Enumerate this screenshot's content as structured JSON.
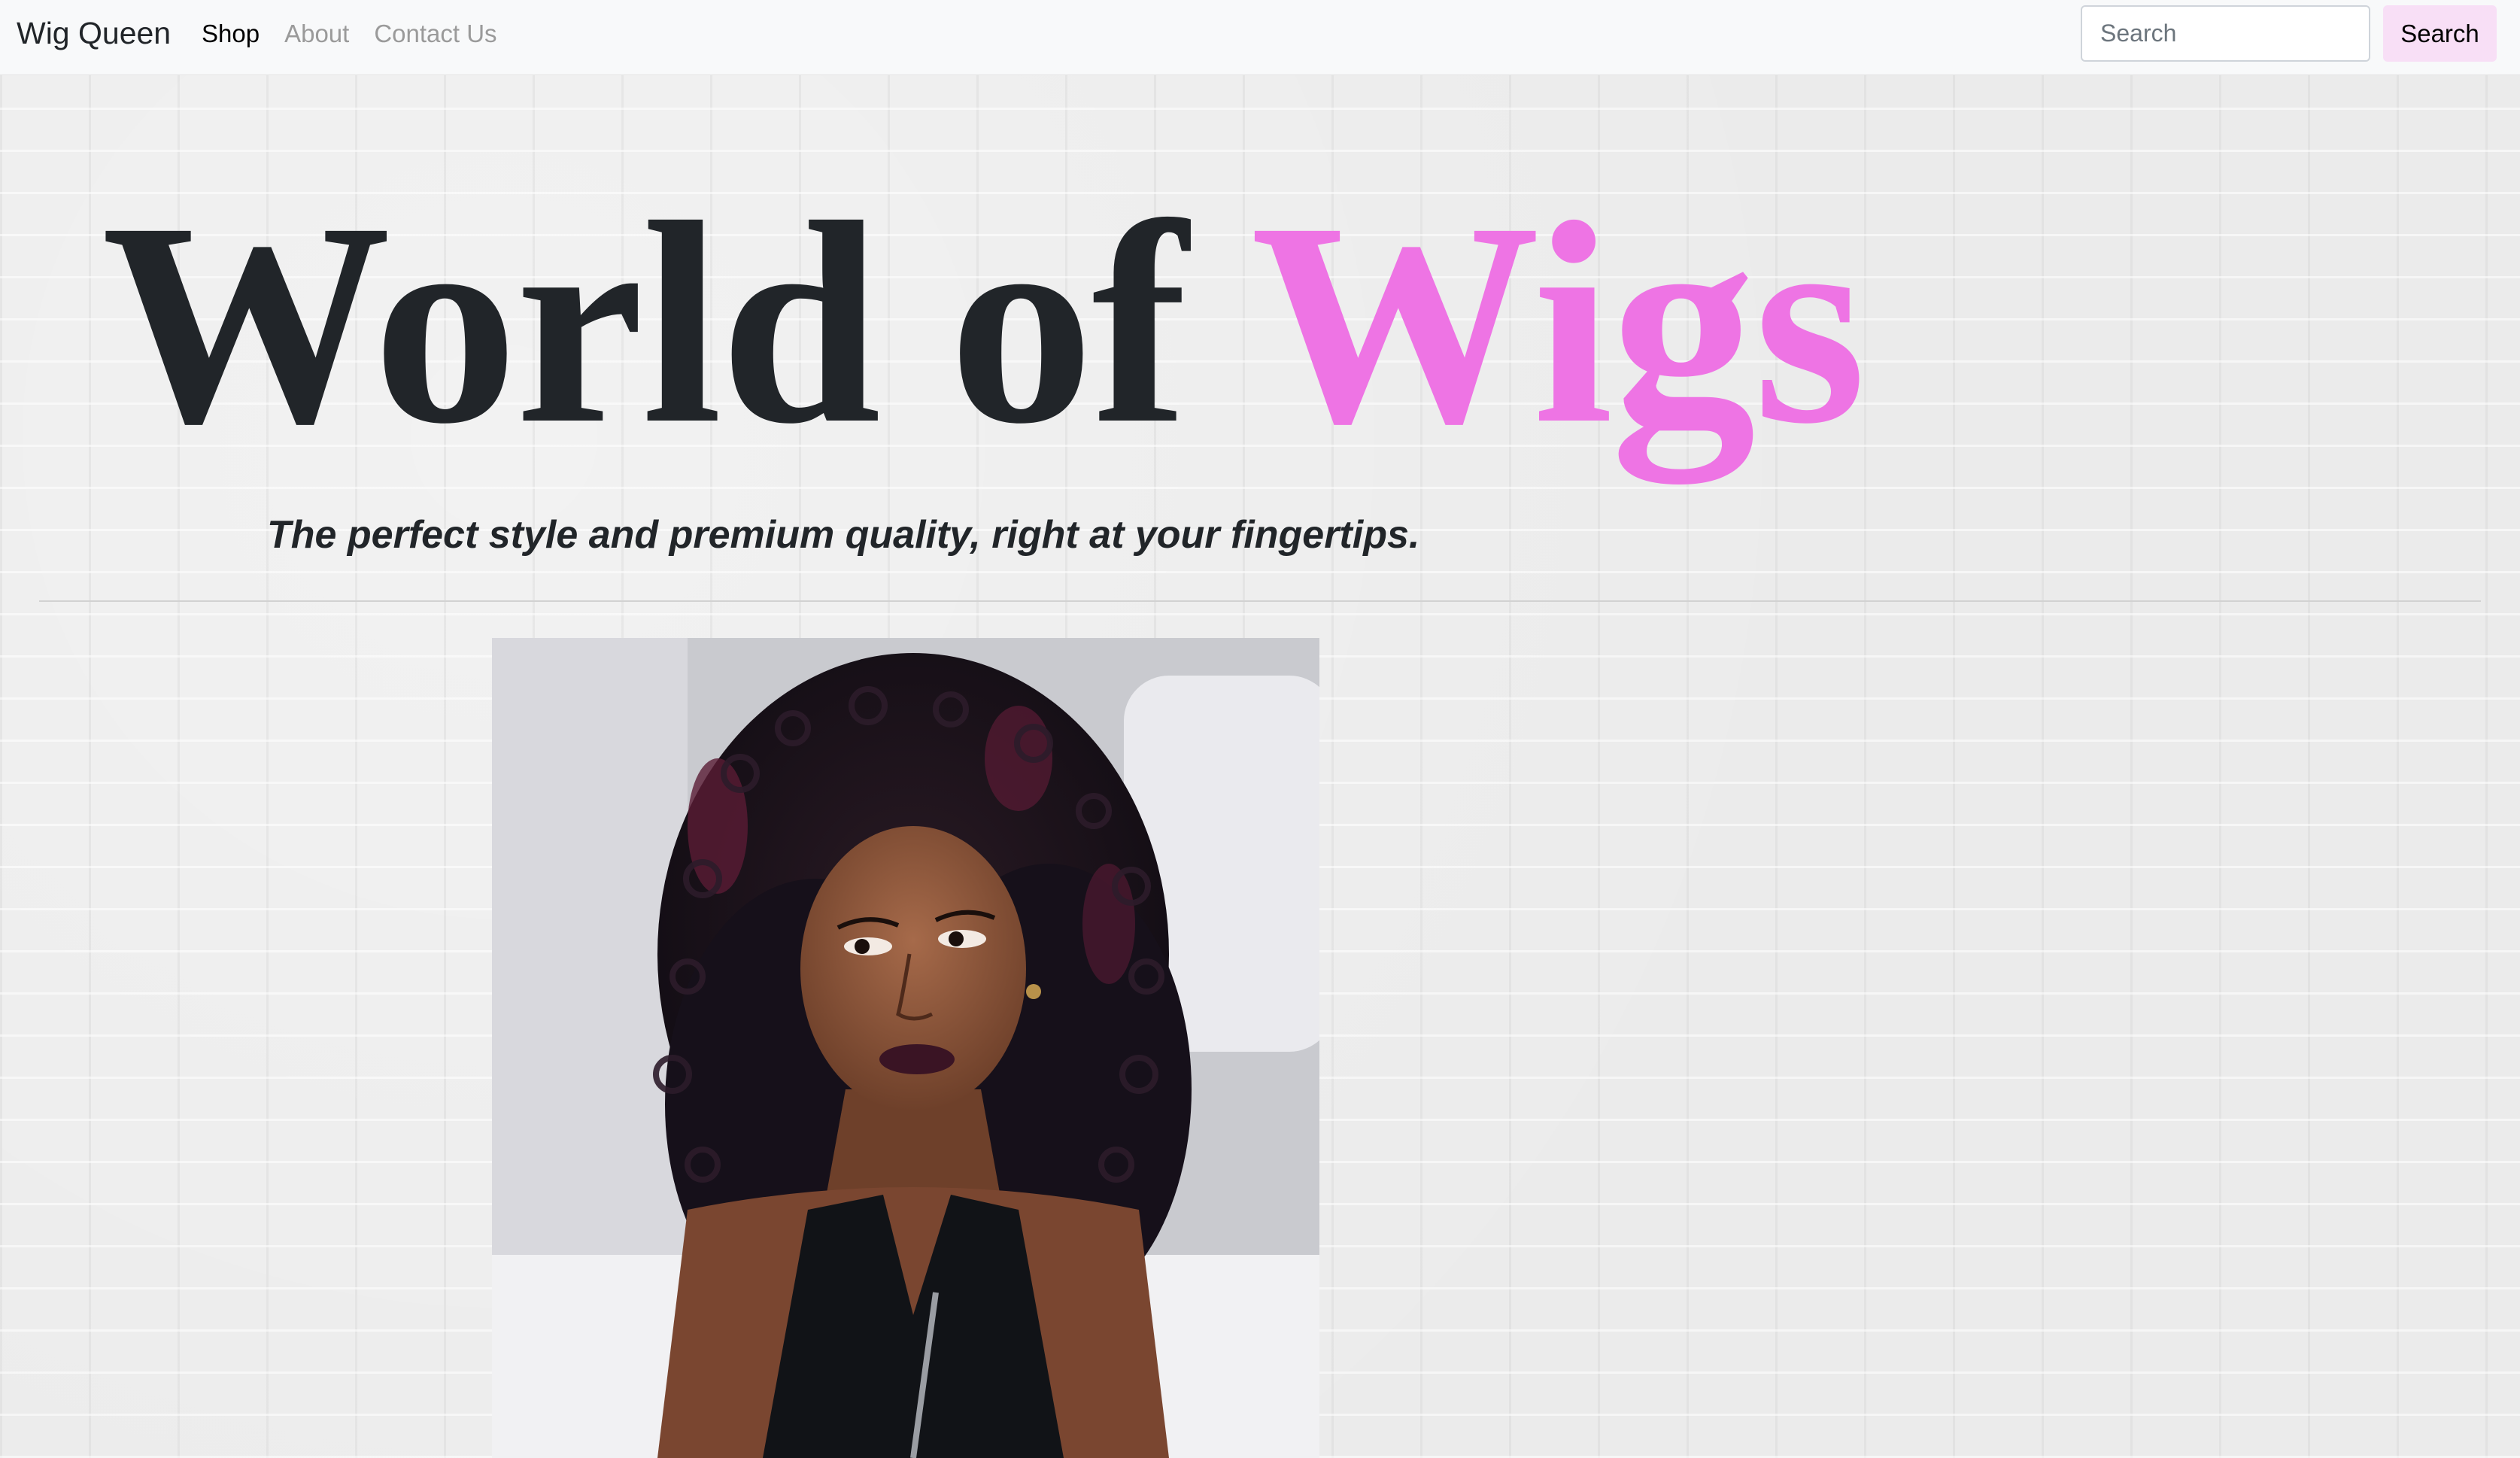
{
  "navbar": {
    "brand": "Wig Queen",
    "links": [
      {
        "label": "Shop",
        "active": true
      },
      {
        "label": "About",
        "active": false
      },
      {
        "label": "Contact Us",
        "active": false
      }
    ],
    "search": {
      "placeholder": "Search",
      "value": "",
      "button_label": "Search"
    }
  },
  "hero": {
    "title_main": "World of",
    "title_accent": "Wigs",
    "subtitle": "The perfect style and premium quality, right at your fingertips."
  },
  "featured_image": {
    "alt": "Woman with curly black and burgundy wig"
  },
  "colors": {
    "accent": "#ee74e4",
    "text": "#212529",
    "search_button_bg": "#f8dff6",
    "navbar_bg": "#f8f9fa"
  }
}
